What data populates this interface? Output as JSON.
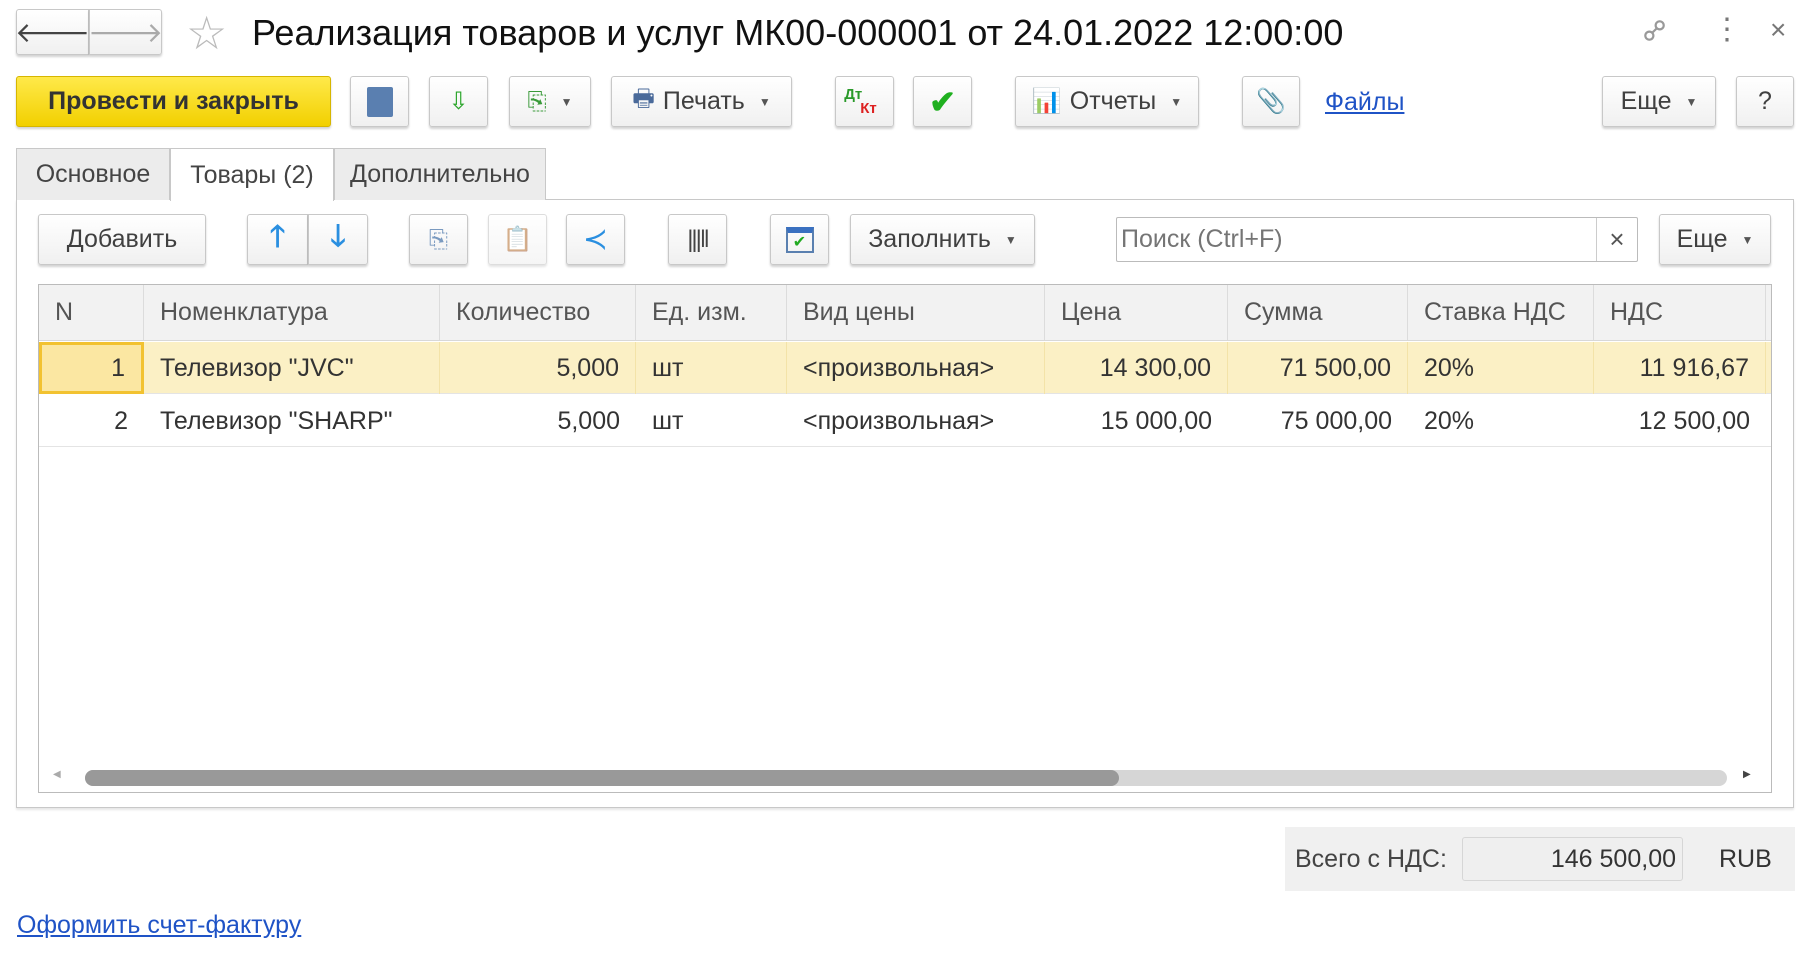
{
  "header": {
    "title": "Реализация товаров и услуг МК00-000001 от 24.01.2022 12:00:00"
  },
  "toolbar": {
    "post_close": "Провести и закрыть",
    "print": "Печать",
    "dtkt_top": "Дт",
    "dtkt_bottom": "Кт",
    "reports": "Отчеты",
    "files": "Файлы",
    "more": "Еще",
    "help": "?"
  },
  "tabs": [
    {
      "label": "Основное"
    },
    {
      "label": "Товары (2)"
    },
    {
      "label": "Дополнительно"
    }
  ],
  "table_toolbar": {
    "add": "Добавить",
    "fill": "Заполнить",
    "search_placeholder": "Поиск (Ctrl+F)",
    "clear": "×",
    "more": "Еще"
  },
  "table": {
    "columns": [
      "N",
      "Номенклатура",
      "Количество",
      "Ед. изм.",
      "Вид цены",
      "Цена",
      "Сумма",
      "Ставка НДС",
      "НДС"
    ],
    "rows": [
      [
        "1",
        "Телевизор \"JVC\"",
        "5,000",
        "шт",
        "<произвольная>",
        "14 300,00",
        "71 500,00",
        "20%",
        "11 916,67"
      ],
      [
        "2",
        "Телевизор \"SHARP\"",
        "5,000",
        "шт",
        "<произвольная>",
        "15 000,00",
        "75 000,00",
        "20%",
        "12 500,00"
      ]
    ],
    "scroll_position": 0.63
  },
  "totals": {
    "label": "Всего с НДС:",
    "value": "146 500,00",
    "currency": "RUB"
  },
  "footer": {
    "invoice_link": "Оформить счет-фактуру"
  },
  "colors": {
    "accent": "#f5d800",
    "selected_row": "#fbf0c5",
    "link": "#1f53c6"
  }
}
